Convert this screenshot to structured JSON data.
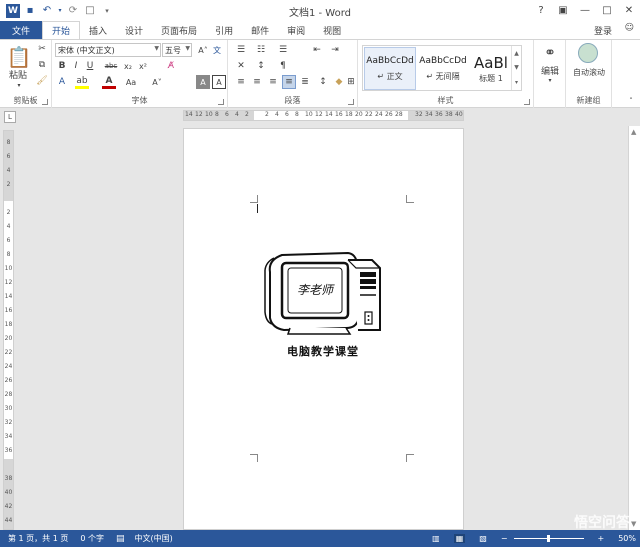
{
  "window": {
    "title": "文档1 - Word",
    "help": "?",
    "login": "登录"
  },
  "qat": [
    "save-icon",
    "undo-icon",
    "redo-icon",
    "new-doc-icon",
    "customize-icon"
  ],
  "tabs": [
    "文件",
    "开始",
    "插入",
    "设计",
    "页面布局",
    "引用",
    "邮件",
    "审阅",
    "视图"
  ],
  "ribbon": {
    "clipboard": {
      "label": "剪贴板",
      "paste": "粘贴"
    },
    "font": {
      "label": "字体",
      "name": "宋体 (中文正文)",
      "size": "五号",
      "bold": "B",
      "italic": "I",
      "underline": "U",
      "strike": "abc",
      "sub": "x₂",
      "sup": "x²"
    },
    "paragraph": {
      "label": "段落"
    },
    "styles": {
      "label": "样式",
      "items": [
        {
          "sample": "AaBbCcDd",
          "name": "↵ 正文"
        },
        {
          "sample": "AaBbCcDd",
          "name": "↵ 无间隔"
        },
        {
          "sample": "AaBl",
          "name": "标题 1"
        }
      ]
    },
    "editing": {
      "label": "编辑"
    },
    "newgroup": {
      "label": "新建组",
      "autoscroll": "自动滚动"
    }
  },
  "ruler": {
    "h": [
      "14",
      "12",
      "10",
      "8",
      "6",
      "4",
      "2",
      "",
      "2",
      "4",
      "6",
      "8",
      "10",
      "12",
      "14",
      "16",
      "18",
      "20",
      "22",
      "24",
      "26",
      "28",
      "",
      "32",
      "34",
      "36",
      "38",
      "40"
    ],
    "v": [
      "8",
      "6",
      "4",
      "2",
      "",
      "2",
      "4",
      "6",
      "8",
      "10",
      "12",
      "14",
      "16",
      "18",
      "20",
      "22",
      "24",
      "26",
      "28",
      "30",
      "32",
      "34",
      "36",
      "",
      "38",
      "40",
      "42",
      "44"
    ]
  },
  "document": {
    "logo_text": "李老师",
    "caption": "电脑教学课堂"
  },
  "status": {
    "page": "第 1 页，共 1 页",
    "words": "0 个字",
    "lang": "中文(中国)",
    "zoom": "50%"
  },
  "watermark": "悟空问答",
  "colors": {
    "accent": "#2b579a",
    "highlight": "#ffff00",
    "font_color": "#c00000"
  }
}
